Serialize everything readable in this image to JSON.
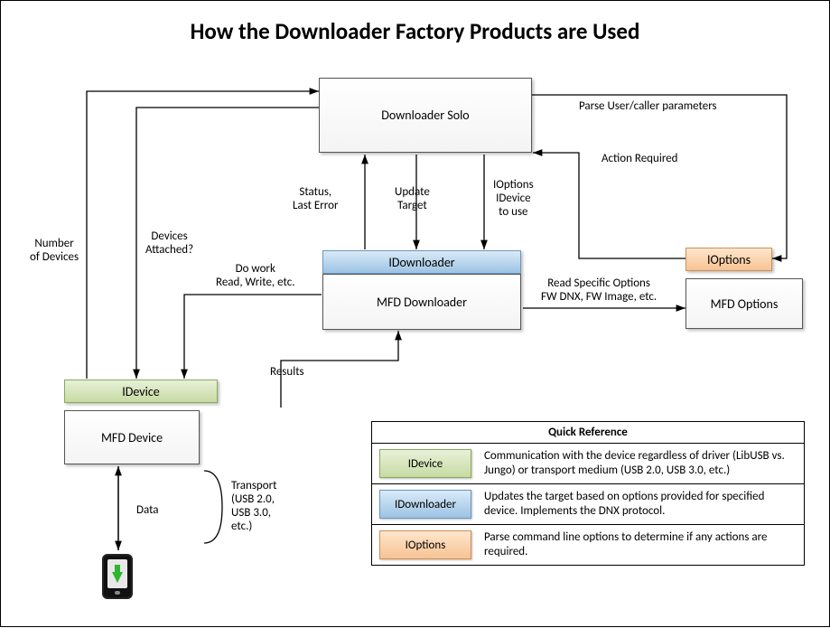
{
  "title": "How the Downloader Factory Products are Used",
  "nodes": {
    "downloaderSolo": "Downloader Solo",
    "iDownloader": "IDownloader",
    "mfdDownloader": "MFD Downloader",
    "iOptions": "IOptions",
    "mfdOptions": "MFD Options",
    "iDevice": "IDevice",
    "mfdDevice": "MFD Device"
  },
  "labels": {
    "parseParams": "Parse User/caller parameters",
    "actionRequired": "Action Required",
    "statusLastError": "Status,\nLast Error",
    "updateTarget": "Update\nTarget",
    "ioptionsIdevice": "IOptions\nIDevice\nto use",
    "readSpecific": "Read Specific Options\nFW DNX, FW Image, etc.",
    "doWork": "Do work\nRead, Write, etc.",
    "results": "Results",
    "devicesAttached": "Devices\nAttached?",
    "numberOfDevices": "Number\nof Devices",
    "data": "Data",
    "transport": "Transport\n(USB 2.0,\nUSB 3.0,\netc.)"
  },
  "quickRef": {
    "heading": "Quick Reference",
    "rows": [
      {
        "chip": "IDevice",
        "chipColor": "green",
        "desc": "Communication with the device regardless of driver (LibUSB vs. Jungo) or transport medium (USB 2.0, USB 3.0, etc.)"
      },
      {
        "chip": "IDownloader",
        "chipColor": "blue",
        "desc": "Updates the target based on options provided for specified device. Implements the DNX protocol."
      },
      {
        "chip": "IOptions",
        "chipColor": "orange",
        "desc": "Parse command line options to determine if any actions are required."
      }
    ]
  }
}
